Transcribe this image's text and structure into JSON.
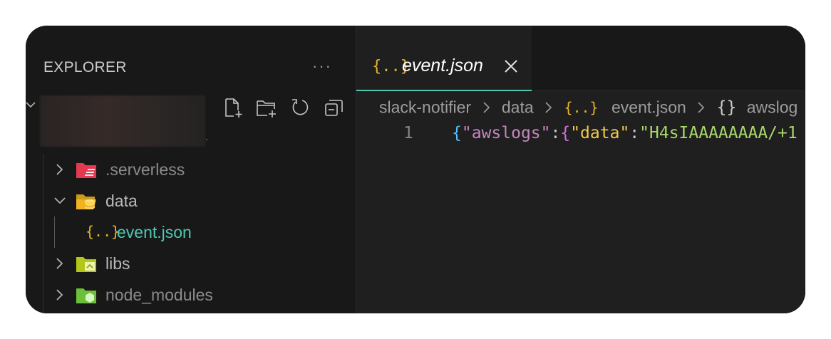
{
  "sidebar": {
    "title": "EXPLORER",
    "more": "···",
    "items": [
      {
        "label": ".serverless",
        "expanded": false,
        "icon": "folder-serverless-icon"
      },
      {
        "label": "data",
        "expanded": true,
        "icon": "folder-database-open-icon"
      },
      {
        "label": "event.json",
        "icon": "json-icon",
        "json_glyph": "{..}",
        "selected": true
      },
      {
        "label": "libs",
        "expanded": false,
        "icon": "folder-lib-icon"
      },
      {
        "label": "node_modules",
        "expanded": false,
        "icon": "folder-node-icon"
      }
    ]
  },
  "tab": {
    "label": "event.json",
    "icon_glyph": "{..}"
  },
  "breadcrumbs": {
    "items": [
      "slack-notifier",
      "data",
      "event.json",
      "awslog"
    ],
    "json_glyph": "{..}",
    "object_glyph": "{}"
  },
  "code": {
    "line_number": "1",
    "brace1": "{",
    "key1": "\"awslogs\"",
    "colon1": ":",
    "brace2": "{",
    "key2": "\"data\"",
    "colon2": ":",
    "value": "\"H4sIAAAAAAAA/+1"
  },
  "colors": {
    "accent": "#4ec9b0",
    "json_icon": "#e8b32c"
  }
}
